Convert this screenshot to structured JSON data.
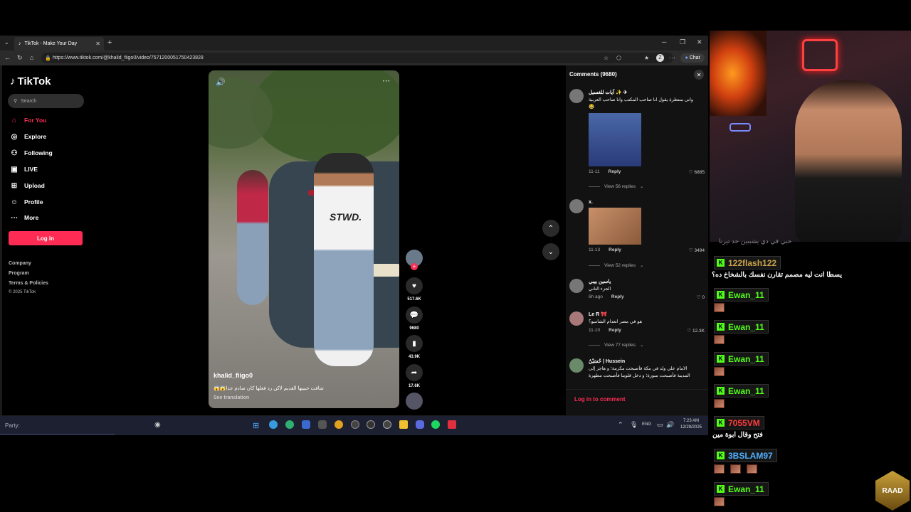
{
  "browser": {
    "tab_title": "TikTok - Make Your Day",
    "url": "https://www.tiktok.com/@khalid_fiigo0/video/7571200051750423828",
    "chat_label": "Chat"
  },
  "sidebar": {
    "logo": "TikTok",
    "search_placeholder": "Search",
    "items": [
      {
        "label": "For You",
        "icon": "home-icon"
      },
      {
        "label": "Explore",
        "icon": "compass-icon"
      },
      {
        "label": "Following",
        "icon": "users-icon"
      },
      {
        "label": "LIVE",
        "icon": "live-icon"
      },
      {
        "label": "Upload",
        "icon": "plus-square-icon"
      },
      {
        "label": "Profile",
        "icon": "user-icon"
      },
      {
        "label": "More",
        "icon": "more-icon"
      }
    ],
    "login": "Log in",
    "footer": [
      "Company",
      "Program",
      "Terms & Policies",
      "© 2025 TikTok"
    ]
  },
  "video": {
    "author": "khalid_fiigo0",
    "caption": "شافت حبيبها القديم لاكن رد فعلها كان صادم جدا😱😱",
    "see_translation": "See translation",
    "shirt_text": "STWD.",
    "likes": "517.6K",
    "comments": "9680",
    "saves": "43.9K",
    "shares": "17.6K"
  },
  "comments": {
    "header": "Comments (9680)",
    "items": [
      {
        "user": "آيات للغسيل ✨ ✈",
        "text": "وانى منتظرة يقول انا صاحب المكتب وانا صاحب العربية 😂",
        "date": "11-11",
        "reply": "Reply",
        "likes": "6885",
        "view_replies": "View 56 replies"
      },
      {
        "user": "x.",
        "text": "",
        "date": "11-13",
        "reply": "Reply",
        "likes": "3494",
        "view_replies": "View 52 replies"
      },
      {
        "user": "ياسين بيبي",
        "text": "الجزء التاني",
        "date": "6h ago",
        "reply": "Reply",
        "likes": "0",
        "view_replies": ""
      },
      {
        "user": "Le R 🎀",
        "text": "هو في مصر انعدام الشامبو؟",
        "date": "11-10",
        "reply": "Reply",
        "likes": "12.3K",
        "view_replies": "View 77 replies"
      },
      {
        "user": "حُسَيْنٌ | Hussein",
        "text": "الامام علي ولد في مكة فأصبحت مكرمة؛ و هاجر إلى المدينة فأصبحت منورة؛ و دخل قلوبنا فأصبحت مطهرة",
        "date": "",
        "reply": "",
        "likes": "",
        "view_replies": ""
      }
    ],
    "login_to_comment": "Log in to comment"
  },
  "taskbar": {
    "party_label": "Party:",
    "time": "7:23 AM",
    "date": "12/29/2025",
    "lang": "ENG"
  },
  "chat": {
    "overlay_text": "حبي في دي يشببين حد تيرنا",
    "messages": [
      {
        "user": "122flash122",
        "color": "#c8a24a",
        "text": "يسطا انت ليه مصمم تقارن نفسك بالشخاخ ده؟"
      },
      {
        "user": "Ewan_11",
        "color": "#53fc18",
        "text": ""
      },
      {
        "user": "Ewan_11",
        "color": "#53fc18",
        "text": ""
      },
      {
        "user": "Ewan_11",
        "color": "#53fc18",
        "text": ""
      },
      {
        "user": "Ewan_11",
        "color": "#53fc18",
        "text": ""
      },
      {
        "user": "7055VM",
        "color": "#ff3b3b",
        "text": "فتح وقال ابوة مين"
      },
      {
        "user": "3BSLAM97",
        "color": "#4fb0ff",
        "text": ""
      },
      {
        "user": "Ewan_11",
        "color": "#53fc18",
        "text": ""
      }
    ],
    "logo_text": "RAAD"
  }
}
